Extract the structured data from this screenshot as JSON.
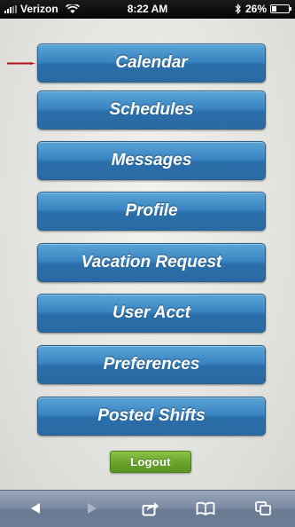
{
  "status_bar": {
    "carrier": "Verizon",
    "time": "8:22 AM",
    "battery": "26%",
    "battery_level": 0.26
  },
  "menu": {
    "items": [
      {
        "label": "Calendar"
      },
      {
        "label": "Schedules"
      },
      {
        "label": "Messages"
      },
      {
        "label": "Profile"
      },
      {
        "label": "Vacation Request"
      },
      {
        "label": "User Acct"
      },
      {
        "label": "Preferences"
      },
      {
        "label": "Posted Shifts"
      }
    ],
    "logout_label": "Logout"
  },
  "toolbar": {
    "icons": [
      "back-arrow-icon",
      "forward-arrow-icon",
      "share-icon",
      "bookmarks-icon",
      "tabs-icon"
    ]
  },
  "colors": {
    "menu_button": "#3a85c3",
    "logout_button": "#6aa52c",
    "toolbar": "#7b8aa2",
    "arrow": "#b0161a"
  }
}
